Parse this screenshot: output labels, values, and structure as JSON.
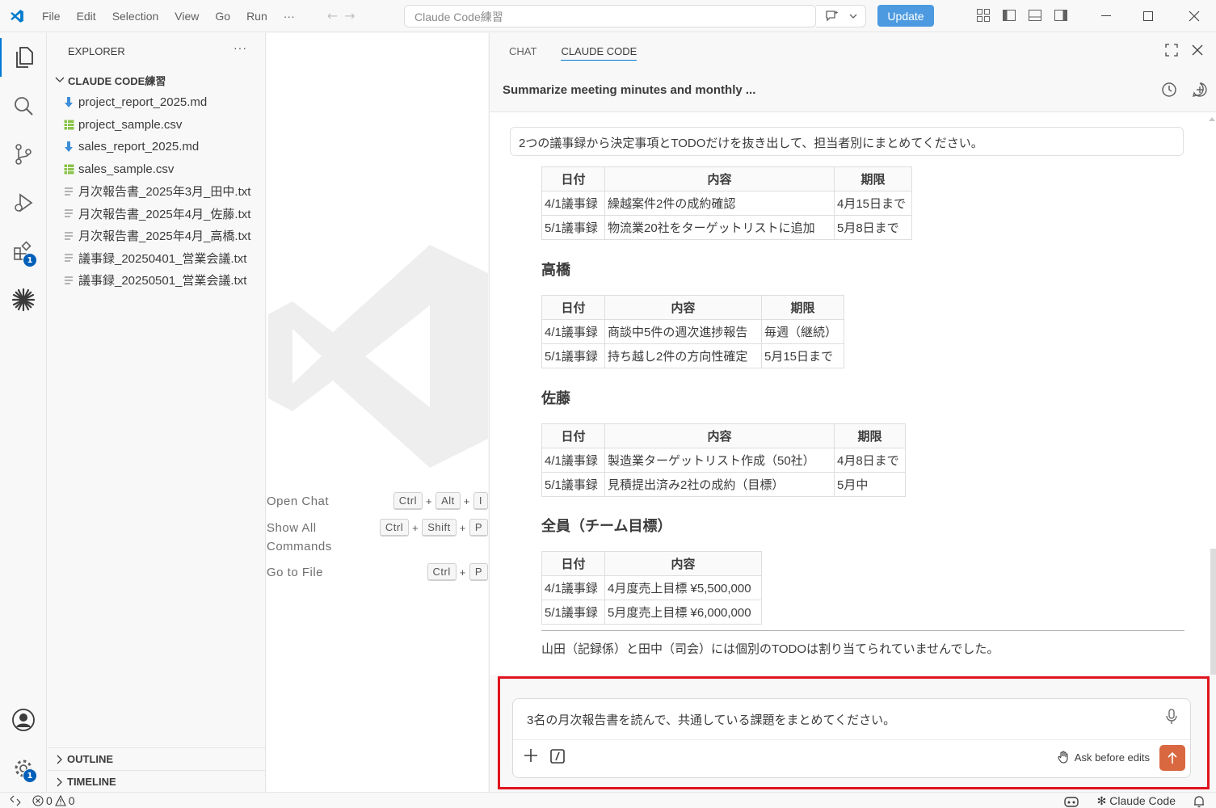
{
  "window": {
    "menu": [
      "File",
      "Edit",
      "Selection",
      "View",
      "Go",
      "Run"
    ],
    "menu_more": "···",
    "search_text": "Claude Code練習",
    "update_label": "Update",
    "brand_color": "#0078d4"
  },
  "activity": {
    "extensions_badge": "1",
    "settings_badge": "1"
  },
  "explorer": {
    "title": "EXPLORER",
    "more": "···",
    "folder": "CLAUDE CODE練習",
    "files": [
      {
        "name": "project_report_2025.md",
        "icon": "markdown-icon"
      },
      {
        "name": "project_sample.csv",
        "icon": "csv-icon"
      },
      {
        "name": "sales_report_2025.md",
        "icon": "markdown-icon"
      },
      {
        "name": "sales_sample.csv",
        "icon": "csv-icon"
      },
      {
        "name": "月次報告書_2025年3月_田中.txt",
        "icon": "text-file-icon"
      },
      {
        "name": "月次報告書_2025年4月_佐藤.txt",
        "icon": "text-file-icon"
      },
      {
        "name": "月次報告書_2025年4月_高橋.txt",
        "icon": "text-file-icon"
      },
      {
        "name": "議事録_20250401_営業会議.txt",
        "icon": "text-file-icon"
      },
      {
        "name": "議事録_20250501_営業会議.txt",
        "icon": "text-file-icon"
      }
    ],
    "outline": "OUTLINE",
    "timeline": "TIMELINE"
  },
  "editor": {
    "shortcuts": [
      {
        "label": "Open Chat",
        "keys": [
          "Ctrl",
          "Alt",
          "I"
        ]
      },
      {
        "label": "Show All Commands",
        "keys": [
          "Ctrl",
          "Shift",
          "P"
        ]
      },
      {
        "label": "Go to File",
        "keys": [
          "Ctrl",
          "P"
        ]
      }
    ],
    "plus": "+"
  },
  "panel": {
    "tabs": [
      "CHAT",
      "CLAUDE CODE"
    ],
    "active_tab": "CLAUDE CODE",
    "session_title": "Summarize meeting minutes and monthly ...",
    "user_message": "2つの議事録から決定事項とTODOだけを抜き出して、担当者別にまとめてください。",
    "table_headers": {
      "date": "日付",
      "content": "内容",
      "deadline": "期限"
    },
    "table_top": [
      [
        "4/1議事録",
        "繰越案件2件の成約確認",
        "4月15日まで"
      ],
      [
        "5/1議事録",
        "物流業20社をターゲットリストに追加",
        "5月8日まで"
      ]
    ],
    "section_takahashi": "高橋",
    "table_takahashi": [
      [
        "4/1議事録",
        "商談中5件の週次進捗報告",
        "毎週（継続）"
      ],
      [
        "5/1議事録",
        "持ち越し2件の方向性確定",
        "5月15日まで"
      ]
    ],
    "section_sato": "佐藤",
    "table_sato": [
      [
        "4/1議事録",
        "製造業ターゲットリスト作成（50社）",
        "4月8日まで"
      ],
      [
        "5/1議事録",
        "見積提出済み2社の成約（目標）",
        "5月中"
      ]
    ],
    "section_all": "全員（チーム目標）",
    "table_all": [
      [
        "4/1議事録",
        "4月度売上目標 ¥5,500,000"
      ],
      [
        "5/1議事録",
        "5月度売上目標 ¥6,000,000"
      ]
    ],
    "footnote": "山田（記録係）と田中（司会）には個別のTODOは割り当てられていませんでした。",
    "input_text": "3名の月次報告書を読んで、共通している課題をまとめてください。",
    "ask_mode": "Ask before edits",
    "send_color": "#d9673f",
    "highlight_color": "#e0141e"
  },
  "status": {
    "errors": "0",
    "warnings": "0",
    "claude_code": "✻ Claude Code"
  }
}
